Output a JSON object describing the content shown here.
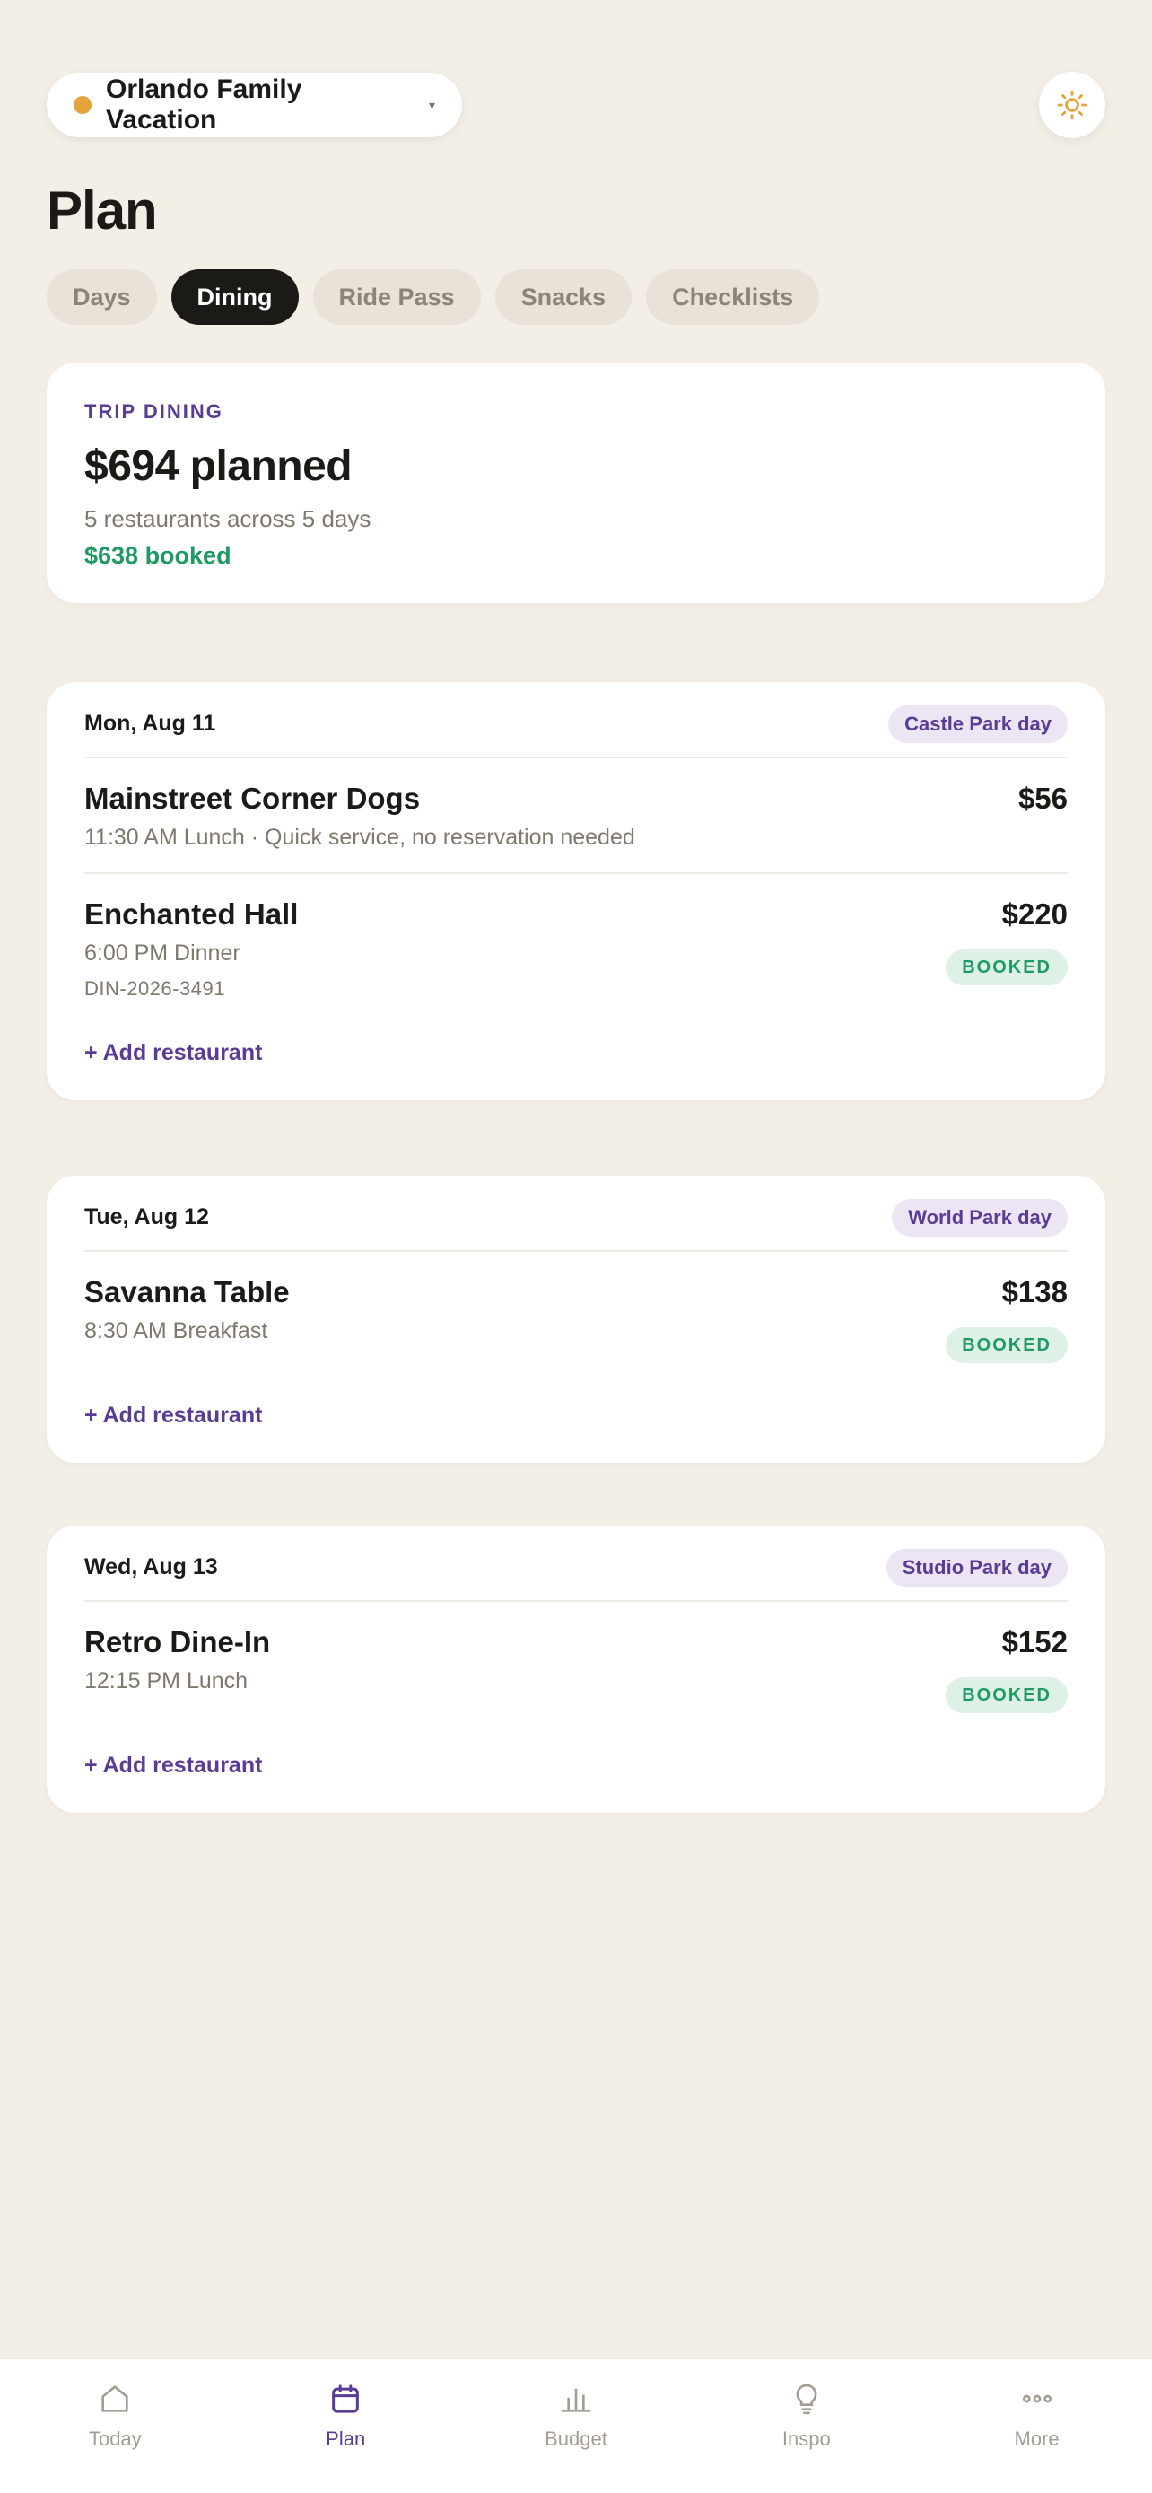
{
  "header": {
    "trip_name": "Orlando Family Vacation",
    "trip_dot_color": "#E5A33B",
    "caret": "▾",
    "theme_icon": "sun-icon"
  },
  "page_title": "Plan",
  "tabs": [
    {
      "label": "Days",
      "active": false
    },
    {
      "label": "Dining",
      "active": true
    },
    {
      "label": "Ride Pass",
      "active": false
    },
    {
      "label": "Snacks",
      "active": false
    },
    {
      "label": "Checklists",
      "active": false
    }
  ],
  "summary": {
    "eyebrow": "TRIP DINING",
    "amount": "$694 planned",
    "subtitle": "5 restaurants across 5 days",
    "booked": "$638 booked"
  },
  "days": [
    {
      "date": "Mon, Aug 11",
      "park": "Castle Park day",
      "add_label": "+ Add restaurant",
      "meals": [
        {
          "name": "Mainstreet Corner Dogs",
          "detail": "11:30 AM Lunch · Quick service, no reservation needed",
          "code": "",
          "price": "$56",
          "status": ""
        },
        {
          "name": "Enchanted Hall",
          "detail": "6:00 PM Dinner",
          "code": "DIN-2026-3491",
          "price": "$220",
          "status": "BOOKED"
        }
      ]
    },
    {
      "date": "Tue, Aug 12",
      "park": "World Park day",
      "add_label": "+ Add restaurant",
      "meals": [
        {
          "name": "Savanna Table",
          "detail": "8:30 AM Breakfast",
          "code": "",
          "price": "$138",
          "status": "BOOKED"
        }
      ]
    },
    {
      "date": "Wed, Aug 13",
      "park": "Studio Park day",
      "add_label": "+ Add restaurant",
      "meals": [
        {
          "name": "Retro Dine-In",
          "detail": "12:15 PM Lunch",
          "code": "",
          "price": "$152",
          "status": "BOOKED"
        }
      ]
    }
  ],
  "nav": [
    {
      "label": "Today",
      "icon": "home-icon",
      "active": false
    },
    {
      "label": "Plan",
      "icon": "calendar-icon",
      "active": true
    },
    {
      "label": "Budget",
      "icon": "bar-chart-icon",
      "active": false
    },
    {
      "label": "Inspo",
      "icon": "lightbulb-icon",
      "active": false
    },
    {
      "label": "More",
      "icon": "more-icon",
      "active": false
    }
  ],
  "colors": {
    "background": "#F3EEE6",
    "accent": "#5A3C96",
    "booked_green": "#1F9A63",
    "dark": "#1B1A17"
  }
}
